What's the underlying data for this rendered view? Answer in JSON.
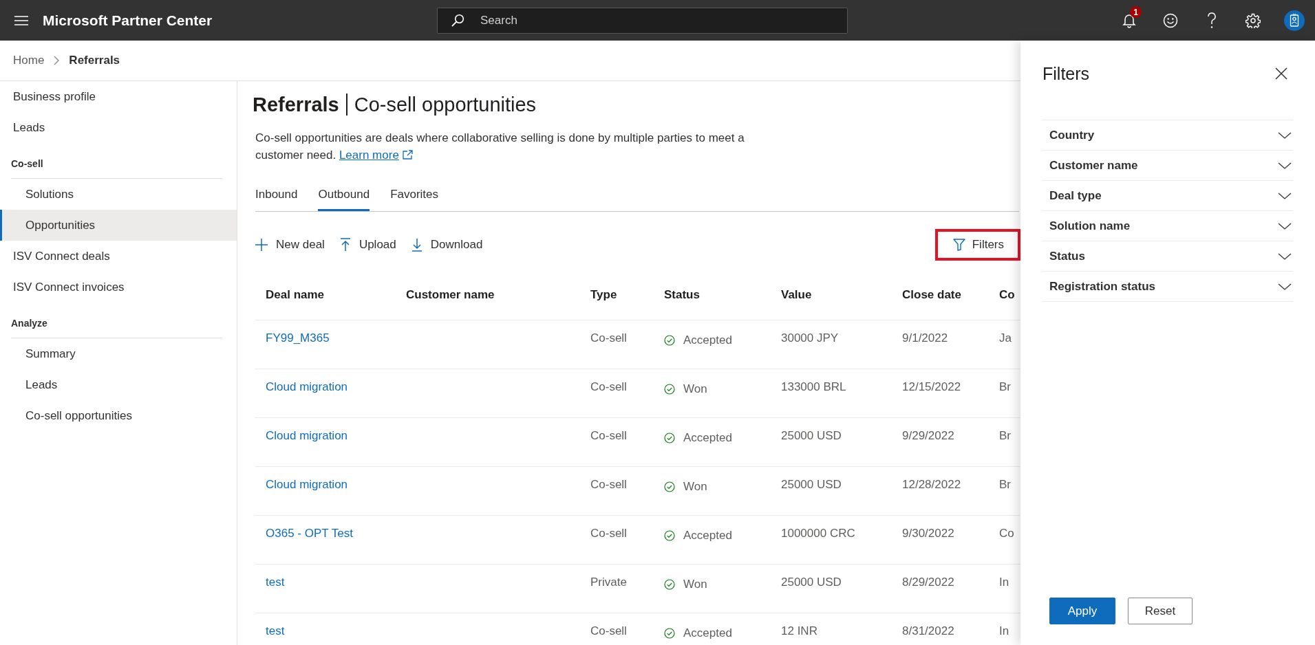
{
  "top_bar": {
    "app_title": "Microsoft Partner Center",
    "search": {
      "placeholder": "Search"
    },
    "notification_count": "1"
  },
  "breadcrumb": [
    {
      "label": "Home",
      "current": false
    },
    {
      "label": "Referrals",
      "current": true
    }
  ],
  "sidebar": {
    "items": [
      {
        "kind": "link",
        "label": "Business profile",
        "selected": false
      },
      {
        "kind": "link",
        "label": "Leads",
        "selected": false
      },
      {
        "kind": "section",
        "label": "Co-sell",
        "children": [
          {
            "label": "Solutions",
            "selected": false
          },
          {
            "label": "Opportunities",
            "selected": true
          }
        ]
      },
      {
        "kind": "link",
        "label": "ISV Connect deals",
        "selected": false
      },
      {
        "kind": "link",
        "label": "ISV Connect invoices",
        "selected": false
      },
      {
        "kind": "section",
        "label": "Analyze",
        "children": [
          {
            "label": "Summary",
            "selected": false
          },
          {
            "label": "Leads",
            "selected": false
          },
          {
            "label": "Co-sell opportunities",
            "selected": false
          }
        ]
      }
    ]
  },
  "page": {
    "title": "Referrals",
    "subtitle": "Co-sell opportunities",
    "description": "Co-sell opportunities are deals where collaborative selling is done by multiple parties to meet a customer need.",
    "learn_more_link": "Learn more"
  },
  "tabs": [
    {
      "label": "Inbound",
      "selected": false
    },
    {
      "label": "Outbound",
      "selected": true
    },
    {
      "label": "Favorites",
      "selected": false
    }
  ],
  "toolbar": {
    "actions": [
      {
        "kind": "new",
        "label": "New deal"
      },
      {
        "kind": "upload",
        "label": "Upload"
      },
      {
        "kind": "download",
        "label": "Download"
      }
    ],
    "filters_button": {
      "label": "Filters",
      "highlighted": true
    }
  },
  "table": {
    "columns": [
      "Deal name",
      "Customer name",
      "Type",
      "Status",
      "Value",
      "Close date",
      "Co"
    ],
    "rows": [
      {
        "deal_name": "FY99_M365",
        "type": "Co-sell",
        "status": "Accepted",
        "value": "30000 JPY",
        "close_date": "9/1/2022",
        "column_7": "Ja"
      },
      {
        "deal_name": "Cloud migration",
        "type": "Co-sell",
        "status": "Won",
        "value": "133000 BRL",
        "close_date": "12/15/2022",
        "column_7": "Br"
      },
      {
        "deal_name": "Cloud migration",
        "type": "Co-sell",
        "status": "Accepted",
        "value": "25000 USD",
        "close_date": "9/29/2022",
        "column_7": "Br"
      },
      {
        "deal_name": "Cloud migration",
        "type": "Co-sell",
        "status": "Won",
        "value": "25000 USD",
        "close_date": "12/28/2022",
        "column_7": "Br"
      },
      {
        "deal_name": "O365 - OPT Test",
        "type": "Co-sell",
        "status": "Accepted",
        "value": "1000000 CRC",
        "close_date": "9/30/2022",
        "column_7": "Co"
      },
      {
        "deal_name": "test",
        "type": "Private",
        "status": "Won",
        "value": "25000 USD",
        "close_date": "8/29/2022",
        "column_7": "In"
      },
      {
        "deal_name": "test",
        "type": "Co-sell",
        "status": "Accepted",
        "value": "12 INR",
        "close_date": "8/31/2022",
        "column_7": "In"
      }
    ]
  },
  "filters_panel": {
    "title": "Filters",
    "sections": [
      {
        "label": "Country",
        "expanded": false
      },
      {
        "label": "Customer name",
        "expanded": false
      },
      {
        "label": "Deal type",
        "expanded": false
      },
      {
        "label": "Solution name",
        "expanded": false
      },
      {
        "label": "Status",
        "expanded": false
      },
      {
        "label": "Registration status",
        "expanded": false
      }
    ],
    "buttons": [
      {
        "kind": "primary",
        "label": "Apply"
      },
      {
        "kind": "secondary",
        "label": "Reset"
      }
    ]
  }
}
